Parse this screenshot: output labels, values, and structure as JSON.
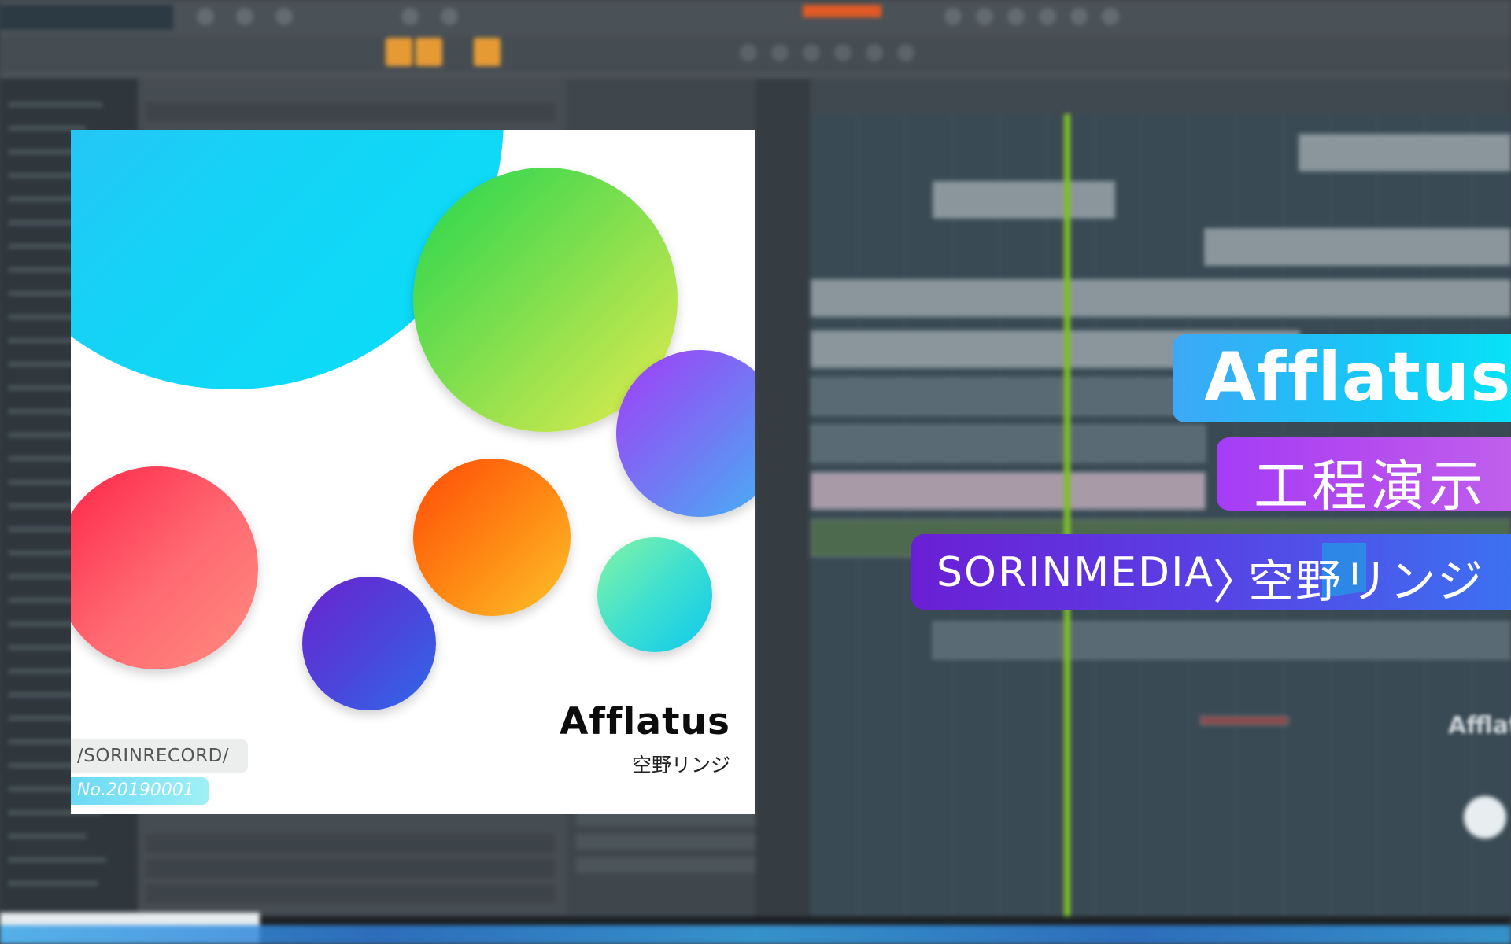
{
  "cover": {
    "title": "Afflatus",
    "artist": "空野リンジ",
    "label": "/SORINRECORD/",
    "catalog": "No.20190001",
    "circle_colors": {
      "big": "#16d2f6",
      "green": "#8ee04e",
      "purple": "#6f7cf4",
      "red": "#ff6a72",
      "orange": "#ff8a14",
      "blue": "#4a46dc",
      "teal": "#3fe0cf"
    }
  },
  "banner": {
    "title": "Afflatus",
    "subtitle": "工程演示",
    "brand": "SORINMEDIA",
    "separator": "〉",
    "artist": "空野リンジ"
  },
  "background_app": {
    "ghost_title": "Afflatus"
  },
  "colors": {
    "accent_cyan": "#15c8f7",
    "accent_purple": "#b44bef",
    "accent_violet": "#5a3ee4",
    "playhead": "#7fbf2a",
    "transport_orange": "#e69a34"
  }
}
